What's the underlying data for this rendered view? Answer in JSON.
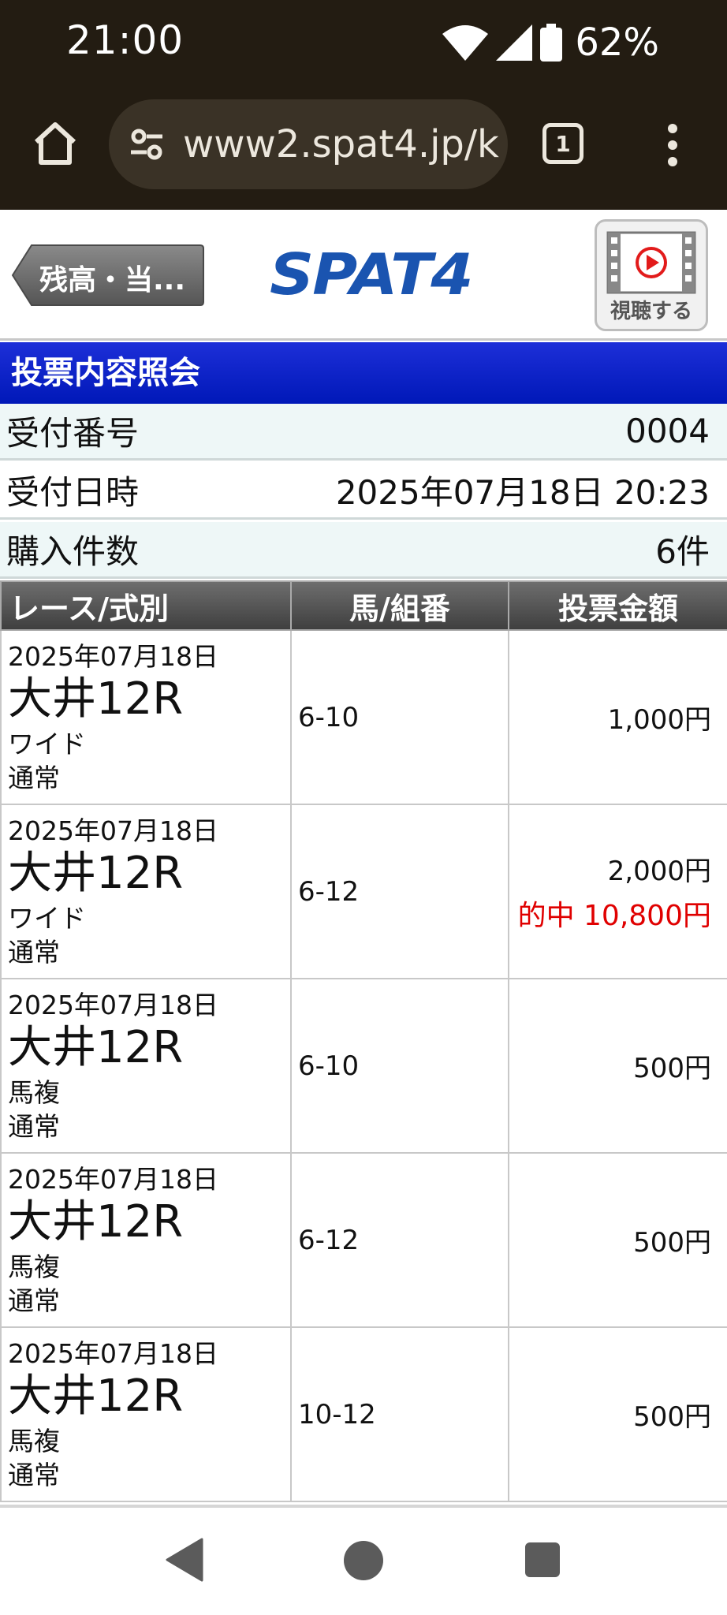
{
  "status_bar": {
    "time": "21:00",
    "battery": "62%"
  },
  "browser": {
    "url": "www2.spat4.jp/k",
    "tab_count": "1"
  },
  "header": {
    "back_label": "残高・当...",
    "logo": "SPAT4",
    "view_label": "視聴する"
  },
  "section_title": "投票内容照会",
  "info": [
    {
      "label": "受付番号",
      "value": "0004"
    },
    {
      "label": "受付日時",
      "value": "2025年07月18日 20:23"
    },
    {
      "label": "購入件数",
      "value": "6件"
    }
  ],
  "table": {
    "headers": [
      "レース/式別",
      "馬/組番",
      "投票金額"
    ],
    "rows": [
      {
        "date": "2025年07月18日",
        "race": "大井12R",
        "type": "ワイド",
        "mode": "通常",
        "combo": "6-10",
        "amount": "1,000円",
        "hit": ""
      },
      {
        "date": "2025年07月18日",
        "race": "大井12R",
        "type": "ワイド",
        "mode": "通常",
        "combo": "6-12",
        "amount": "2,000円",
        "hit": "的中  10,800円"
      },
      {
        "date": "2025年07月18日",
        "race": "大井12R",
        "type": "馬複",
        "mode": "通常",
        "combo": "6-10",
        "amount": "500円",
        "hit": ""
      },
      {
        "date": "2025年07月18日",
        "race": "大井12R",
        "type": "馬複",
        "mode": "通常",
        "combo": "6-12",
        "amount": "500円",
        "hit": ""
      },
      {
        "date": "2025年07月18日",
        "race": "大井12R",
        "type": "馬複",
        "mode": "通常",
        "combo": "10-12",
        "amount": "500円",
        "hit": ""
      }
    ]
  },
  "colors": {
    "accent_blue": "#0018b8",
    "logo_blue": "#1a54b0",
    "hit_red": "#e00000",
    "chrome_bg": "#231c12"
  },
  "icons": [
    "home-icon",
    "site-settings-icon",
    "tabs-icon",
    "more-vert-icon",
    "play-video-icon",
    "wifi-icon",
    "signal-icon",
    "battery-icon"
  ]
}
